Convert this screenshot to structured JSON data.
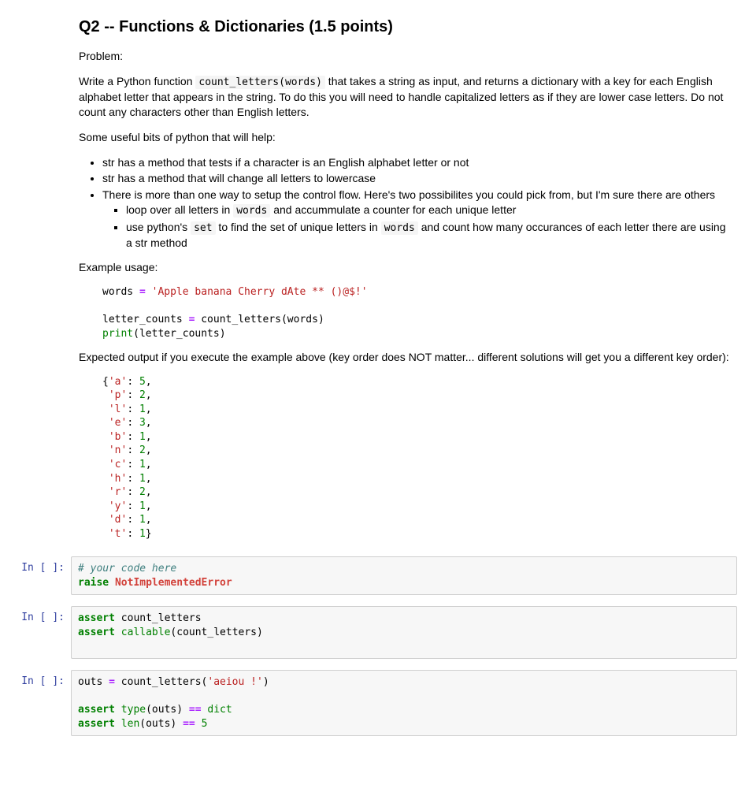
{
  "doc": {
    "heading": "Q2 -- Functions & Dictionaries (1.5 points)",
    "problem_label": "Problem:",
    "problem_p1_a": "Write a Python function ",
    "problem_code1": "count_letters(words)",
    "problem_p1_b": " that takes a string as input, and returns a dictionary with a key for each English alphabet letter that appears in the string. To do this you will need to handle capitalized letters as if they are lower case letters. Do not count any characters other than English letters.",
    "intro_hints": "Some useful bits of python that will help:",
    "bullet1": "str has a method that tests if a character is an English alphabet letter or not",
    "bullet2": "str has a method that will change all letters to lowercase",
    "bullet3": "There is more than one way to setup the control flow. Here's two possibilites you could pick from, but I'm sure there are others",
    "sub1_a": "loop over all letters in ",
    "sub1_code": "words",
    "sub1_b": " and accummulate a counter for each unique letter",
    "sub2_a": "use python's ",
    "sub2_code1": "set",
    "sub2_b": " to find the set of unique letters in ",
    "sub2_code2": "words",
    "sub2_c": " and count how many occurances of each letter there are using a str method",
    "example_label": "Example usage:",
    "expected_label": "Expected output if you execute the example above (key order does NOT matter... different solutions will get you a different key order):"
  },
  "example_code": {
    "line1_a": "words ",
    "line1_eq": "=",
    "line1_b": " ",
    "line1_str": "'Apple banana Cherry dAte ** ()@$!'",
    "line3_a": "letter_counts ",
    "line3_eq": "=",
    "line3_b": " count_letters(words)",
    "line4_print": "print",
    "line4_b": "(letter_counts)"
  },
  "expected_output": {
    "open": "{",
    "close": "}",
    "pairs": [
      {
        "k": "'a'",
        "v": "5"
      },
      {
        "k": "'p'",
        "v": "2"
      },
      {
        "k": "'l'",
        "v": "1"
      },
      {
        "k": "'e'",
        "v": "3"
      },
      {
        "k": "'b'",
        "v": "1"
      },
      {
        "k": "'n'",
        "v": "2"
      },
      {
        "k": "'c'",
        "v": "1"
      },
      {
        "k": "'h'",
        "v": "1"
      },
      {
        "k": "'r'",
        "v": "2"
      },
      {
        "k": "'y'",
        "v": "1"
      },
      {
        "k": "'d'",
        "v": "1"
      },
      {
        "k": "'t'",
        "v": "1"
      }
    ]
  },
  "cells": {
    "prompt": "In [ ]:",
    "c1": {
      "comment": "# your code here",
      "kw": "raise",
      "exc": "NotImplementedError"
    },
    "c2": {
      "kw": "assert",
      "id1": "count_letters",
      "call": "callable",
      "arg": "(count_letters)"
    },
    "c3": {
      "line1_a": "outs ",
      "eq": "=",
      "line1_b": " count_letters(",
      "str": "'aeiou !'",
      "line1_c": ")",
      "kw": "assert",
      "type_bi": "type",
      "type_arg": "(outs) ",
      "eqeq": "==",
      "dict_bi": "dict",
      "len_bi": "len",
      "len_arg": "(outs) ",
      "five": "5"
    }
  }
}
